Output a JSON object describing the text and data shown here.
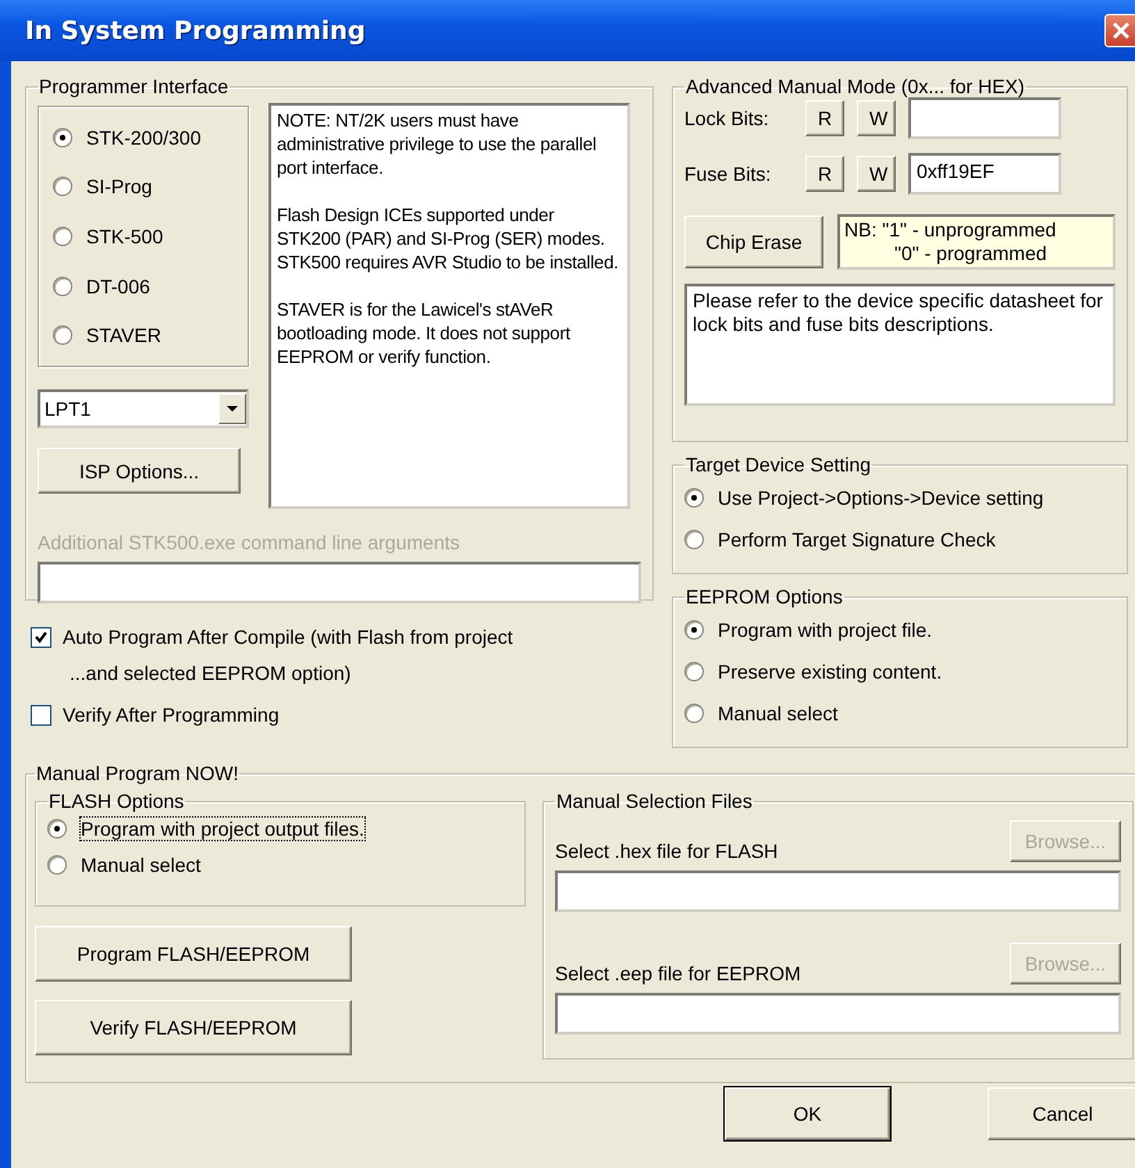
{
  "window": {
    "title": "In System Programming"
  },
  "programmer_interface": {
    "title": "Programmer Interface",
    "options": [
      {
        "label": "STK-200/300",
        "selected": true
      },
      {
        "label": "SI-Prog",
        "selected": false
      },
      {
        "label": "STK-500",
        "selected": false
      },
      {
        "label": "DT-006",
        "selected": false
      },
      {
        "label": "STAVER",
        "selected": false
      }
    ],
    "port": {
      "value": "LPT1"
    },
    "isp_options_button": "ISP Options...",
    "note": [
      "NOTE: NT/2K users must have administrative privilege to use the parallel port interface.",
      "Flash Design ICEs supported under STK200 (PAR) and SI-Prog (SER) modes. STK500 requires AVR Studio to be installed.",
      "STAVER is for the Lawicel's stAVeR bootloading mode. It does not support EEPROM or verify function."
    ],
    "arguments": {
      "label": "Additional STK500.exe command line arguments",
      "disabled": true
    }
  },
  "checkboxes": [
    {
      "label": "Auto Program After Compile (with Flash from project",
      "continuation": "...and selected EEPROM option)",
      "checked": true
    },
    {
      "label": "Verify After Programming",
      "checked": false
    }
  ],
  "advanced_manual_mode": {
    "title": "Advanced Manual Mode (0x... for HEX)",
    "rows": [
      {
        "label": "Lock Bits:",
        "read": "R",
        "write": "W"
      },
      {
        "label": "Fuse Bits:",
        "read": "R",
        "write": "W",
        "value": "0xff19EF"
      }
    ],
    "chip_erase": "Chip Erase",
    "nb": [
      "NB: \"1\" - unprogrammed",
      "\"0\" - programmed"
    ],
    "info": "Please refer to the device specific datasheet for lock bits and fuse bits descriptions."
  },
  "target_device_setting": {
    "title": "Target Device Setting",
    "options": [
      {
        "label": "Use Project->Options->Device setting",
        "selected": true
      },
      {
        "label": "Perform Target Signature Check",
        "selected": false
      }
    ]
  },
  "eeprom_options": {
    "title": "EEPROM Options",
    "options": [
      {
        "label": "Program with project file.",
        "selected": true
      },
      {
        "label": "Preserve existing content.",
        "selected": false
      },
      {
        "label": "Manual select",
        "selected": false
      }
    ]
  },
  "manual_program": {
    "title": "Manual Program NOW!",
    "flash_options": {
      "title": "FLASH Options",
      "options": [
        {
          "label": "Program with project output files.",
          "selected": true,
          "focused": true
        },
        {
          "label": "Manual select",
          "selected": false,
          "focused": false
        }
      ]
    },
    "buttons": [
      "Program FLASH/EEPROM",
      "Verify FLASH/EEPROM"
    ],
    "files": {
      "title": "Manual Selection Files",
      "items": [
        {
          "label": "Select .hex file for FLASH",
          "browse": "Browse...",
          "disabled": true
        },
        {
          "label": "Select .eep file for EEPROM",
          "browse": "Browse...",
          "disabled": true
        }
      ]
    }
  },
  "buttons": [
    {
      "label": "OK",
      "default": true
    },
    {
      "label": "Cancel",
      "default": false
    }
  ]
}
